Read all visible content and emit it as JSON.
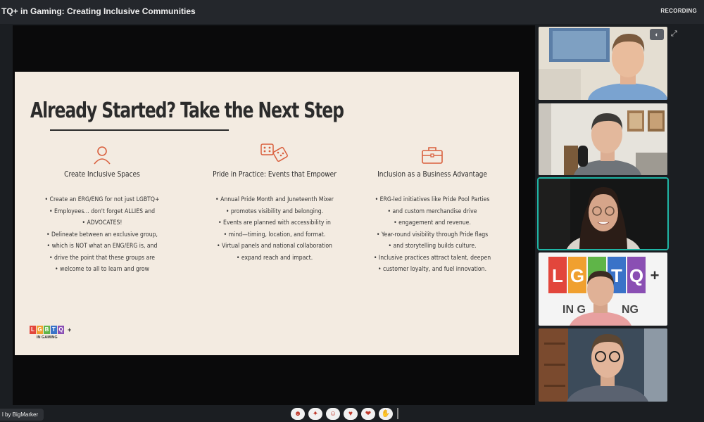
{
  "header": {
    "title": "TQ+ in Gaming: Creating Inclusive Communities",
    "recording_label": "RECORDING"
  },
  "slide": {
    "title": "Already Started? Take the Next Step",
    "columns": [
      {
        "icon": "person-icon",
        "heading": "Create Inclusive Spaces",
        "bullets": [
          "Create an ERG/ENG for not just LGBTQ+",
          "Employees... don't forget ALLIES and",
          "ADVOCATES!",
          "Delineate between an exclusive group,",
          "which is NOT what an ENG/ERG is, and",
          "drive the point that these groups are",
          "welcome to all to learn and grow"
        ]
      },
      {
        "icon": "dice-icon",
        "heading": "Pride in Practice: Events that Empower",
        "bullets": [
          "Annual Pride Month and Juneteenth Mixer",
          "promotes visibility and belonging.",
          "Events are planned with accessibility in",
          "mind—timing, location, and format.",
          "Virtual panels and national collaboration",
          "expand reach and impact."
        ]
      },
      {
        "icon": "briefcase-icon",
        "heading": "Inclusion as a Business Advantage",
        "bullets": [
          "ERG-led initiatives like Pride Pool Parties",
          "and custom merchandise drive",
          "engagement and revenue.",
          "Year-round visibility through Pride flags",
          "and storytelling builds culture.",
          "Inclusive practices attract talent, deepen",
          "customer loyalty, and fuel innovation."
        ]
      }
    ],
    "logo": {
      "letters": [
        "L",
        "G",
        "B",
        "T",
        "Q"
      ],
      "plus": "+",
      "subtitle": "IN GAMING"
    }
  },
  "participants": [
    {
      "name": "participant-1",
      "active": false
    },
    {
      "name": "participant-2",
      "active": false
    },
    {
      "name": "participant-3",
      "active": true
    },
    {
      "name": "participant-4",
      "active": false,
      "banner_letters": [
        "L",
        "G",
        "B",
        "T",
        "Q"
      ],
      "banner_plus": "+",
      "banner_sub": "IN GAMING"
    },
    {
      "name": "participant-5",
      "active": false
    }
  ],
  "footer": {
    "brand": "l by BigMarker"
  },
  "reactions": [
    "face-icon",
    "party-icon",
    "laugh-icon",
    "heart-icon",
    "love-icon",
    "clap-icon"
  ],
  "colors": {
    "accent_teal": "#1fb5a5",
    "slide_bg": "#f3ebe1",
    "icon_red": "#d9603e"
  }
}
